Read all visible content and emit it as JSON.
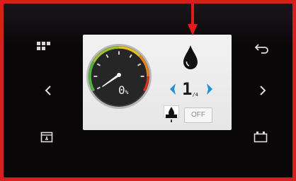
{
  "gauge": {
    "readout": "0",
    "unit": "%",
    "needle_fraction": 0.0
  },
  "drop_level": {
    "value": "1",
    "suffix": "/4"
  },
  "controls": {
    "off_label": "OFF"
  },
  "icons": {
    "top_left": "grid-icon",
    "mid_left": "chevron-left-icon",
    "bottom_left": "tray-icon",
    "top_right": "back-arrow-icon",
    "mid_right": "chevron-right-icon",
    "bottom_right": "battery-icon",
    "screen_top": "drop-icon",
    "screen_pan": "drip-pan-icon"
  },
  "colors": {
    "marker": "#e21b1b",
    "accent_blue": "#1f8fd8",
    "bezel": "#0a0709",
    "screen": "#eeeeee",
    "gauge_green": "#4fb43a",
    "gauge_yellow": "#e6c21e",
    "gauge_orange": "#e8821e",
    "gauge_red": "#d8321e"
  }
}
